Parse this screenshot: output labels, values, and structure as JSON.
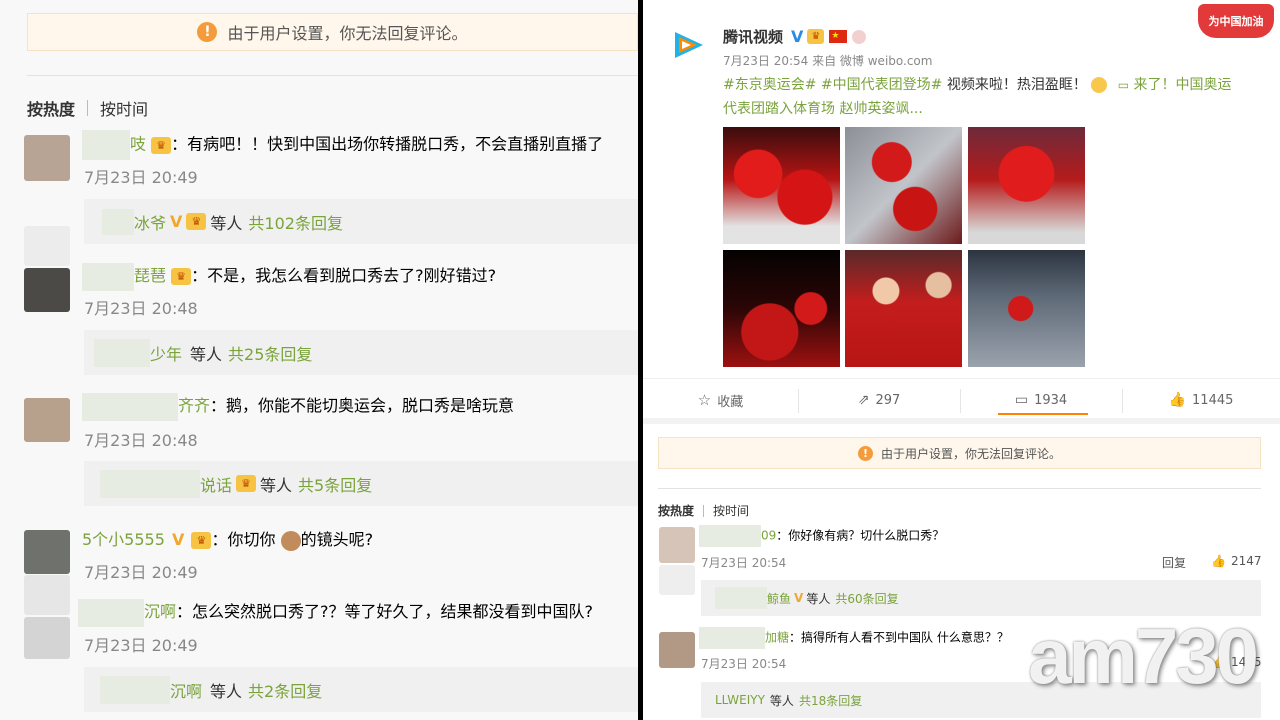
{
  "left": {
    "notice": "由于用户设置，你无法回复评论。",
    "sort_hot": "按热度",
    "sort_time": "按时间",
    "comments": [
      {
        "name": "吱",
        "text": "：有病吧！！快到中国出场你转播脱口秀，不会直播别直播了",
        "time": "7月23日 20:49",
        "reply_name": "冰爷",
        "reply_mid": "等人",
        "reply_count": "共102条回复"
      },
      {
        "name": "琵琶",
        "text": "：不是，我怎么看到脱口秀去了?刚好错过?",
        "time": "7月23日 20:48",
        "reply_name": "少年",
        "reply_mid": "等人",
        "reply_count": "共25条回复"
      },
      {
        "name": "齐齐",
        "text": "：鹅，你能不能切奥运会，脱口秀是啥玩意",
        "time": "7月23日 20:48",
        "reply_name": "说话",
        "reply_mid": "等人",
        "reply_count": "共5条回复"
      },
      {
        "name": "5个小5555",
        "text": "：你切你",
        "text2": "的镜头呢?",
        "time": "7月23日 20:49"
      },
      {
        "name": "沉啊",
        "text": "：怎么突然脱口秀了?？等了好久了，结果都没看到中国队?",
        "time": "7月23日 20:49",
        "reply_name": "沉啊",
        "reply_mid": "等人",
        "reply_count": "共2条回复"
      }
    ]
  },
  "right": {
    "banner": "为中国加油",
    "account": "腾讯视频",
    "meta": "7月23日 20:54 来自 微博 weibo.com",
    "post_line1_tags": "#东京奥运会# #中国代表团登场#",
    "post_line1_text": " 视频来啦！热泪盈眶！",
    "post_line1_link": " 来了！中国奥运",
    "post_line2_link": "代表团踏入体育场 赵帅英姿飒...",
    "actions": {
      "fav": "收藏",
      "repost": "297",
      "comment": "1934",
      "like": "11445"
    },
    "notice": "由于用户设置，你无法回复评论。",
    "sort_hot": "按热度",
    "sort_time": "按时间",
    "comments": [
      {
        "name": "09",
        "text": "：你好像有病？切什么脱口秀？",
        "time": "7月23日 20:54",
        "reply": "回复",
        "likes": "2147",
        "reply_name": "鲸鱼",
        "reply_mid": "等人",
        "reply_count": "共60条回复"
      },
      {
        "name": "加糖",
        "text": "：搞得所有人看不到中国队 什么意思？？",
        "time": "7月23日 20:54",
        "likes": "1495",
        "reply_name": "LLWEIYY",
        "reply_mid": "等人",
        "reply_count": "共18条回复"
      }
    ],
    "watermark": "am730"
  },
  "colors": {
    "green": "#7aa33b",
    "notice_bg": "#fff7ec",
    "warn": "#f49b3c"
  }
}
